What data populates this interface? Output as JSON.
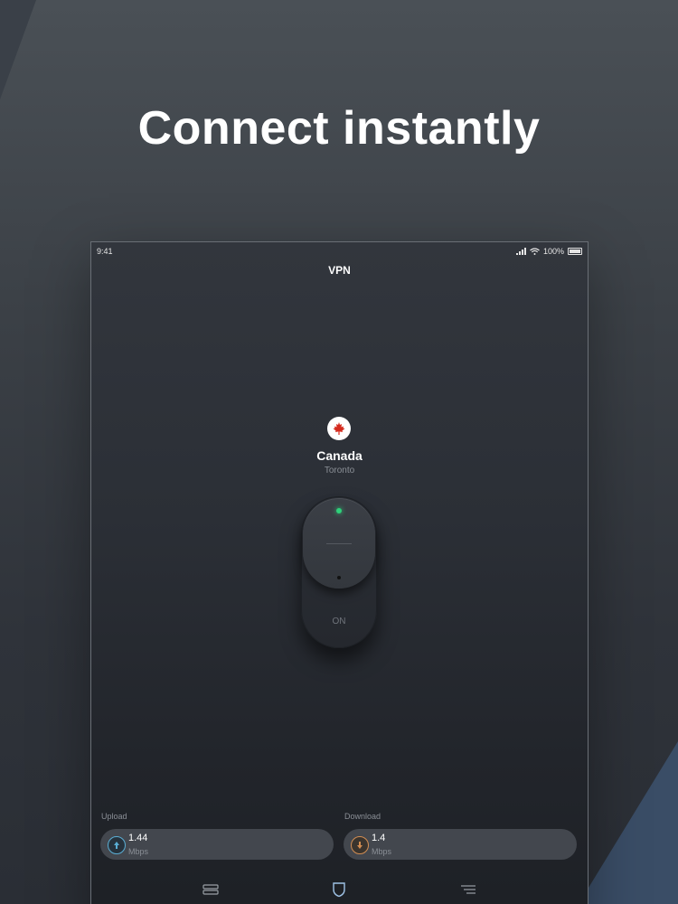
{
  "headline": "Connect instantly",
  "status_bar": {
    "time": "9:41",
    "battery": "100%"
  },
  "app": {
    "title": "VPN",
    "location": {
      "country": "Canada",
      "city": "Toronto"
    },
    "toggle": {
      "state_label": "ON"
    },
    "upload": {
      "title": "Upload",
      "value": "1.44",
      "unit": "Mbps"
    },
    "download": {
      "title": "Download",
      "value": "1.4",
      "unit": "Mbps"
    },
    "tabs": [
      "servers-icon",
      "shield-icon",
      "menu-icon"
    ]
  },
  "colors": {
    "connected": "#2ed17a",
    "upload_accent": "#5aaed4",
    "download_accent": "#d28d52"
  }
}
